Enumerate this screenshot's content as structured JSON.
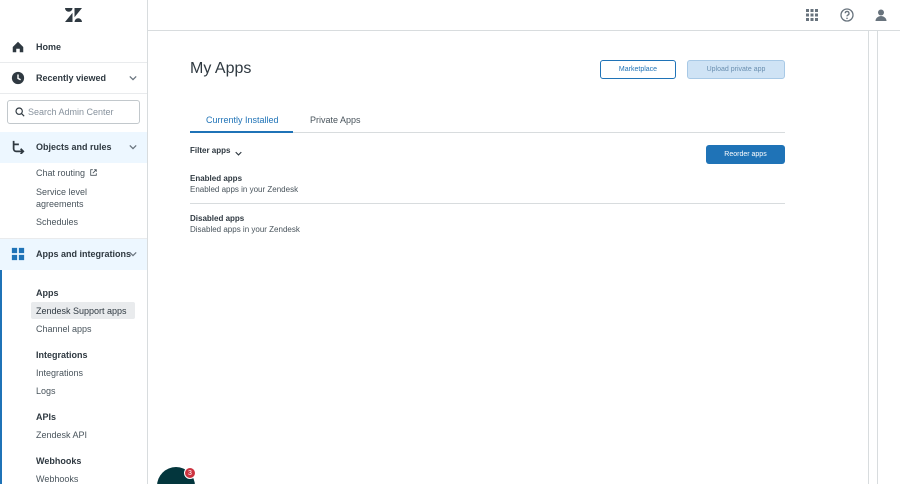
{
  "sidebar": {
    "home_label": "Home",
    "recently_viewed_label": "Recently viewed",
    "search_placeholder": "Search Admin Center",
    "objects_rules": {
      "label": "Objects and rules",
      "items": [
        {
          "label": "Chat routing",
          "external": true
        },
        {
          "label": "Service level agreements"
        },
        {
          "label": "Schedules"
        }
      ]
    },
    "apps_integrations": {
      "label": "Apps and integrations",
      "groups": [
        {
          "title": "Apps",
          "items": [
            "Zendesk Support apps",
            "Channel apps"
          ]
        },
        {
          "title": "Integrations",
          "items": [
            "Integrations",
            "Logs"
          ]
        },
        {
          "title": "APIs",
          "items": [
            "Zendesk API"
          ]
        },
        {
          "title": "Webhooks",
          "items": [
            "Webhooks"
          ]
        }
      ]
    }
  },
  "topbar": {
    "icons": [
      "apps-grid-icon",
      "help-icon",
      "user-avatar-icon"
    ]
  },
  "main": {
    "title": "My Apps",
    "marketplace_button": "Marketplace",
    "upload_button": "Upload private app",
    "tabs": [
      "Currently Installed",
      "Private Apps"
    ],
    "selected_tab": "Currently Installed",
    "filter_label": "Filter apps",
    "reorder_button": "Reorder apps",
    "enabled": {
      "title": "Enabled apps",
      "subtitle": "Enabled apps in your Zendesk"
    },
    "disabled": {
      "title": "Disabled apps",
      "subtitle": "Disabled apps in your Zendesk"
    }
  },
  "chat_widget": {
    "badge_count": "3"
  },
  "colors": {
    "accent": "#1f73b7",
    "text": "#2f3941",
    "border": "#d8dcde",
    "active_bg": "#edf7ff"
  }
}
